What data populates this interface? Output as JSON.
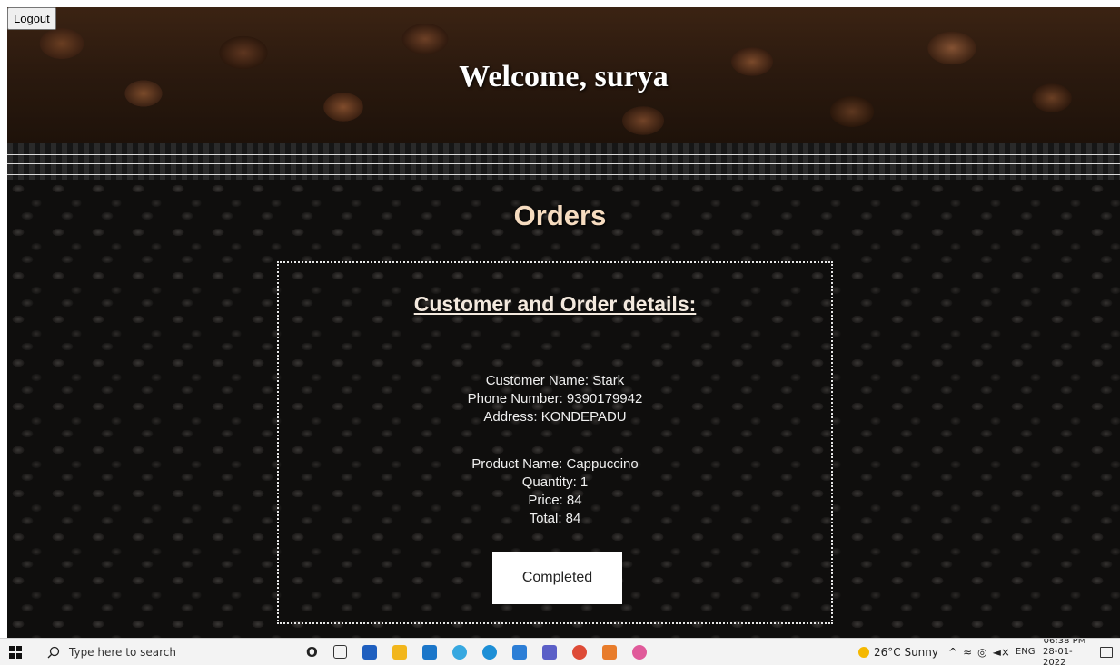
{
  "header": {
    "logout_label": "Logout",
    "welcome_text": "Welcome, surya"
  },
  "main": {
    "section_title": "Orders",
    "details_heading": "Customer and Order details:",
    "customer": {
      "name": "Customer Name: Stark",
      "phone": "Phone Number: 9390179942",
      "address": "Address: KONDEPADU"
    },
    "order": {
      "product": "Product Name: Cappuccino",
      "quantity": "Quantity: 1",
      "price": "Price: 84",
      "total": "Total: 84"
    },
    "completed_label": "Completed"
  },
  "taskbar": {
    "search_placeholder": "Type here to search",
    "weather": "26°C  Sunny",
    "language": "ENG",
    "time": "06:38 PM",
    "date": "28-01-2022"
  },
  "colors": {
    "section_title": "#f6dcc0",
    "card_border": "#e6e6e6",
    "button_bg": "#ffffff"
  }
}
